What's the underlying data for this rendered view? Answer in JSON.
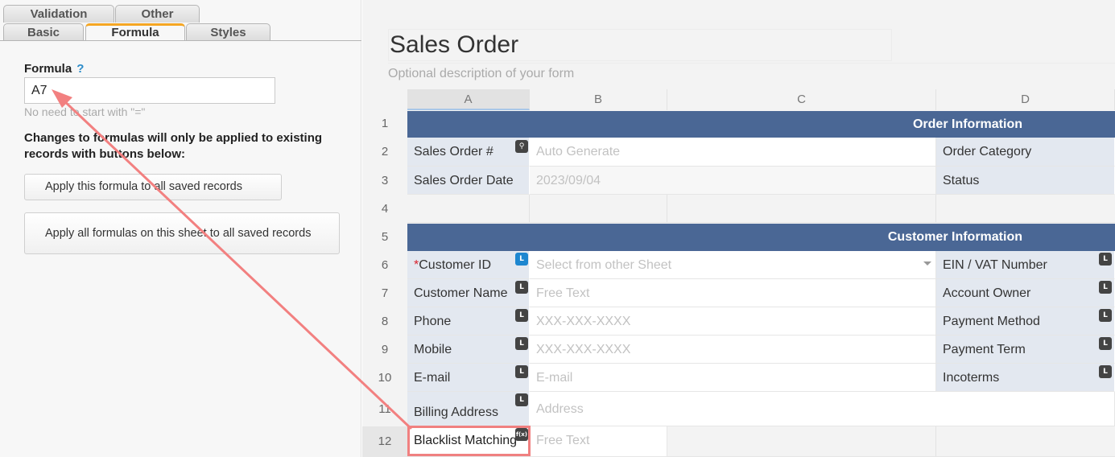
{
  "tabs": {
    "validation": "Validation",
    "other": "Other",
    "basic": "Basic",
    "formula": "Formula",
    "styles": "Styles"
  },
  "formula_panel": {
    "label": "Formula",
    "help": "?",
    "value": "A7",
    "hint": "No need to start with \"=\"",
    "note": "Changes to formulas will only be applied to existing records with buttons below:",
    "apply_one": "Apply this formula to all saved records",
    "apply_all": "Apply all formulas on this sheet to all saved records"
  },
  "form": {
    "title": "Sales Order",
    "description": "Optional description of your form"
  },
  "columns": [
    "A",
    "B",
    "C",
    "D"
  ],
  "rows": [
    "1",
    "2",
    "3",
    "4",
    "5",
    "6",
    "7",
    "8",
    "9",
    "10",
    "11",
    "12"
  ],
  "sections": {
    "order_info": "Order Information",
    "customer_info": "Customer Information"
  },
  "fields": {
    "sales_order_no": "Sales Order #",
    "sales_order_no_placeholder": "Auto Generate",
    "order_category": "Order Category",
    "sales_order_date": "Sales Order Date",
    "sales_order_date_value": "2023/09/04",
    "status": "Status",
    "customer_id_required": "*",
    "customer_id": "Customer ID",
    "customer_id_placeholder": "Select from other Sheet",
    "ein_vat": "EIN / VAT Number",
    "customer_name": "Customer Name",
    "customer_name_placeholder": "Free Text",
    "account_owner": "Account Owner",
    "phone": "Phone",
    "phone_placeholder": "XXX-XXX-XXXX",
    "payment_method": "Payment Method",
    "mobile": "Mobile",
    "mobile_placeholder": "XXX-XXX-XXXX",
    "payment_term": "Payment Term",
    "email": "E-mail",
    "email_placeholder": "E-mail",
    "incoterms": "Incoterms",
    "billing_address": "Billing Address",
    "billing_address_placeholder": "Address",
    "blacklist_matching": "Blacklist Matching",
    "blacklist_placeholder": "Free Text"
  },
  "badges": {
    "link": "L",
    "formula": "f(x)"
  },
  "colors": {
    "section_header": "#4a6795",
    "label_cell": "#e3e8f0",
    "highlight": "#f08080",
    "active_tab_accent": "#f5a623"
  }
}
